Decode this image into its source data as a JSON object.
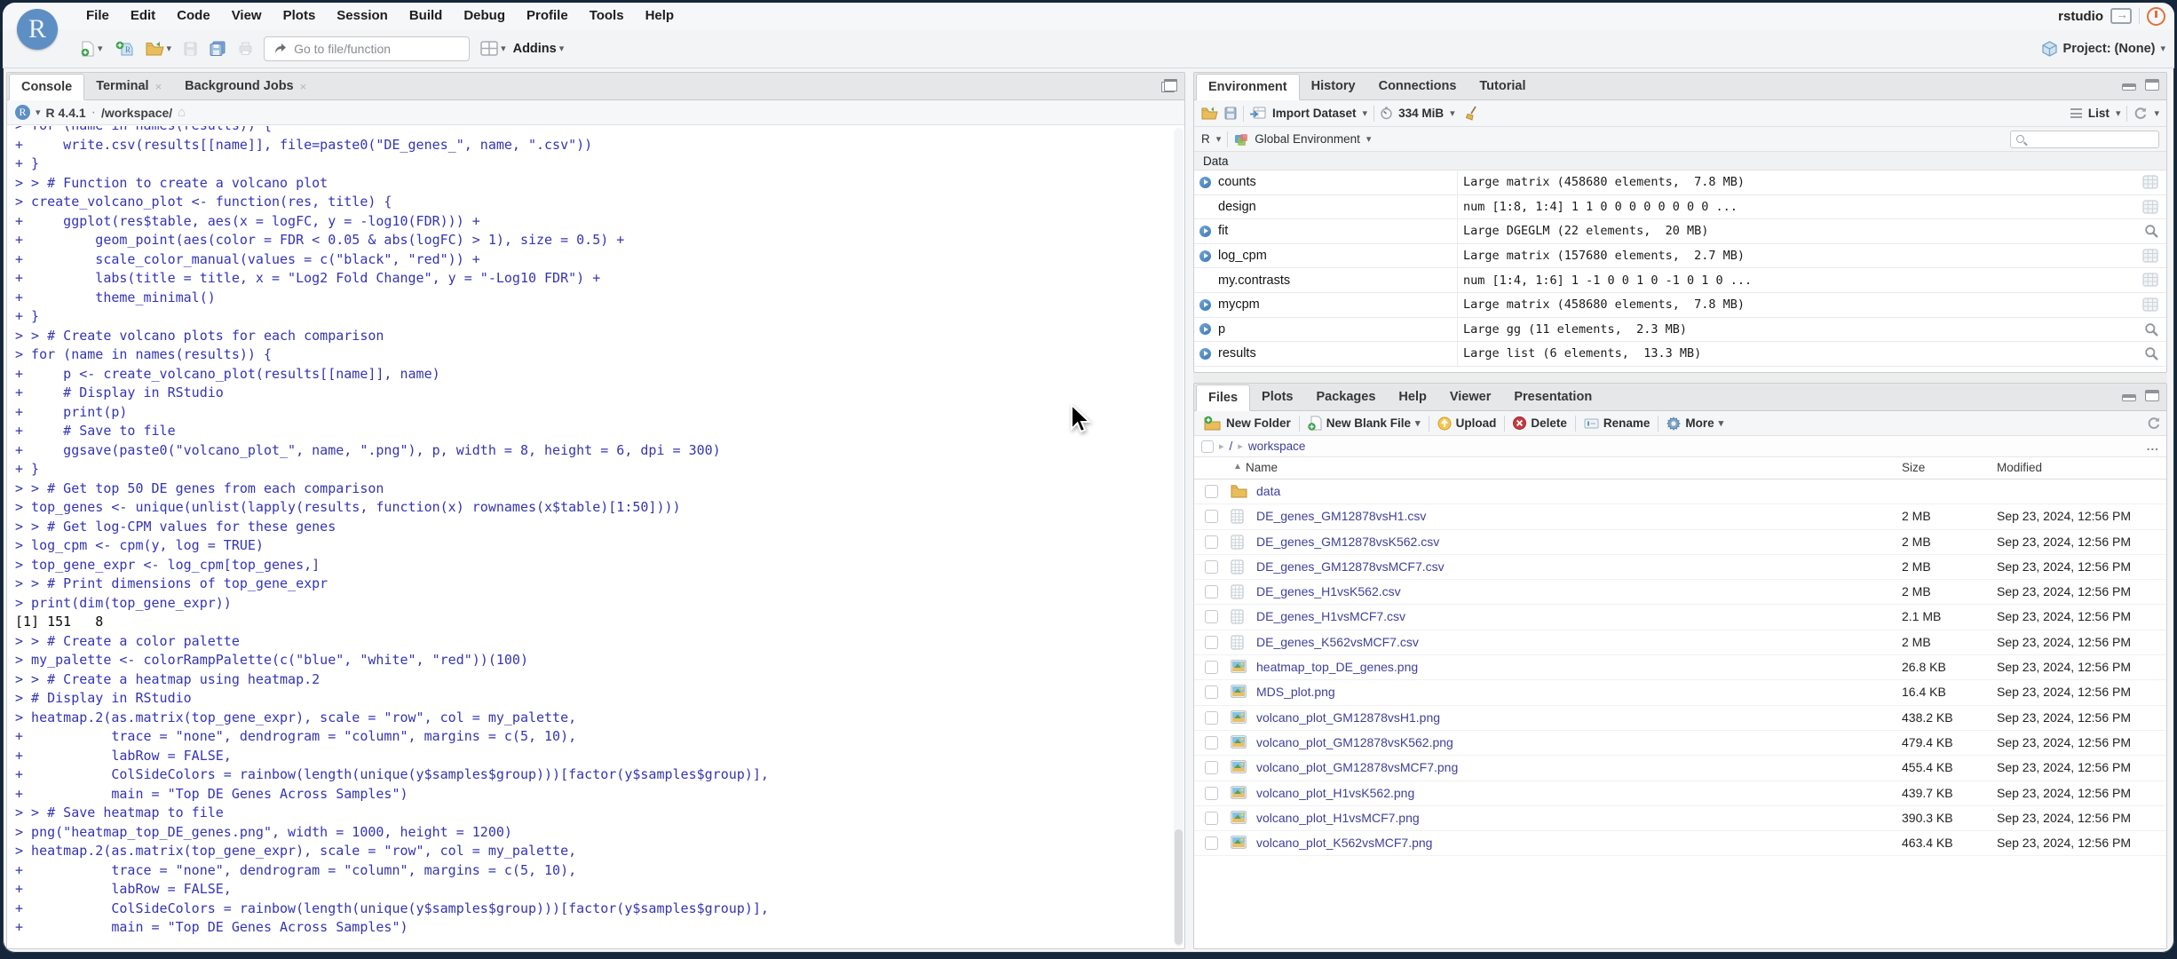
{
  "menubar": {
    "logo_letter": "R",
    "items": [
      "File",
      "Edit",
      "Code",
      "View",
      "Plots",
      "Session",
      "Build",
      "Debug",
      "Profile",
      "Tools",
      "Help"
    ],
    "session_label": "rstudio"
  },
  "toolbar": {
    "buttons": [
      {
        "icon": "new-file-icon",
        "dropdown": true
      },
      {
        "icon": "new-project-icon",
        "dropdown": false
      },
      {
        "icon": "open-file-icon",
        "dropdown": true
      },
      {
        "icon": "save-icon",
        "dropdown": false
      },
      {
        "icon": "save-all-icon",
        "dropdown": false
      },
      {
        "icon": "print-icon",
        "dropdown": false
      }
    ],
    "goto_placeholder": "Go to file/function",
    "addins_label": "Addins",
    "project_label": "Project: (None)"
  },
  "console": {
    "tabs": [
      {
        "label": "Console",
        "active": true,
        "closable": false
      },
      {
        "label": "Terminal",
        "active": false,
        "closable": true
      },
      {
        "label": "Background Jobs",
        "active": false,
        "closable": true
      }
    ],
    "r_version": "R 4.4.1",
    "separator": "·",
    "working_dir": "/workspace/",
    "lines": [
      {
        "t": "> for (name in names(results)) {"
      },
      {
        "t": "+     write.csv(results[[name]], file=paste0(\"DE_genes_\", name, \".csv\"))"
      },
      {
        "t": "+ }"
      },
      {
        "t": "> > # Function to create a volcano plot"
      },
      {
        "t": "> create_volcano_plot <- function(res, title) {"
      },
      {
        "t": "+     ggplot(res$table, aes(x = logFC, y = -log10(FDR))) +"
      },
      {
        "t": "+         geom_point(aes(color = FDR < 0.05 & abs(logFC) > 1), size = 0.5) +"
      },
      {
        "t": "+         scale_color_manual(values = c(\"black\", \"red\")) +"
      },
      {
        "t": "+         labs(title = title, x = \"Log2 Fold Change\", y = \"-Log10 FDR\") +"
      },
      {
        "t": "+         theme_minimal()"
      },
      {
        "t": "+ }"
      },
      {
        "t": "> > # Create volcano plots for each comparison"
      },
      {
        "t": "> for (name in names(results)) {"
      },
      {
        "t": "+     p <- create_volcano_plot(results[[name]], name)"
      },
      {
        "t": "+     # Display in RStudio"
      },
      {
        "t": "+     print(p)"
      },
      {
        "t": "+     # Save to file"
      },
      {
        "t": "+     ggsave(paste0(\"volcano_plot_\", name, \".png\"), p, width = 8, height = 6, dpi = 300)"
      },
      {
        "t": "+ }"
      },
      {
        "t": "> > # Get top 50 DE genes from each comparison"
      },
      {
        "t": "> top_genes <- unique(unlist(lapply(results, function(x) rownames(x$table)[1:50])))"
      },
      {
        "t": "> > # Get log-CPM values for these genes"
      },
      {
        "t": "> log_cpm <- cpm(y, log = TRUE)"
      },
      {
        "t": "> top_gene_expr <- log_cpm[top_genes,]"
      },
      {
        "t": "> > # Print dimensions of top_gene_expr"
      },
      {
        "t": "> print(dim(top_gene_expr))"
      },
      {
        "t": "[1] 151   8",
        "o": true
      },
      {
        "t": "> > # Create a color palette"
      },
      {
        "t": "> my_palette <- colorRampPalette(c(\"blue\", \"white\", \"red\"))(100)"
      },
      {
        "t": "> > # Create a heatmap using heatmap.2"
      },
      {
        "t": "> # Display in RStudio"
      },
      {
        "t": "> heatmap.2(as.matrix(top_gene_expr), scale = \"row\", col = my_palette,"
      },
      {
        "t": "+           trace = \"none\", dendrogram = \"column\", margins = c(5, 10),"
      },
      {
        "t": "+           labRow = FALSE,"
      },
      {
        "t": "+           ColSideColors = rainbow(length(unique(y$samples$group)))[factor(y$samples$group)],"
      },
      {
        "t": "+           main = \"Top DE Genes Across Samples\")"
      },
      {
        "t": "> > # Save heatmap to file"
      },
      {
        "t": "> png(\"heatmap_top_DE_genes.png\", width = 1000, height = 1200)"
      },
      {
        "t": "> heatmap.2(as.matrix(top_gene_expr), scale = \"row\", col = my_palette,"
      },
      {
        "t": "+           trace = \"none\", dendrogram = \"column\", margins = c(5, 10),"
      },
      {
        "t": "+           labRow = FALSE,"
      },
      {
        "t": "+           ColSideColors = rainbow(length(unique(y$samples$group)))[factor(y$samples$group)],"
      },
      {
        "t": "+           main = \"Top DE Genes Across Samples\")"
      }
    ]
  },
  "environment": {
    "tabs": [
      {
        "label": "Environment",
        "active": true
      },
      {
        "label": "History",
        "active": false
      },
      {
        "label": "Connections",
        "active": false
      },
      {
        "label": "Tutorial",
        "active": false
      }
    ],
    "import_label": "Import Dataset",
    "memory_label": "334 MiB",
    "list_label": "List",
    "r_scope_label": "R",
    "env_scope_label": "Global Environment",
    "section_label": "Data",
    "items": [
      {
        "name": "counts",
        "value": "Large matrix (458680 elements,  7.8 MB)",
        "expandable": true,
        "action": "grid-icon"
      },
      {
        "name": "design",
        "value": "num [1:8, 1:4] 1 1 0 0 0 0 0 0 0 0 ...",
        "expandable": false,
        "action": "grid-icon"
      },
      {
        "name": "fit",
        "value": "Large DGEGLM (22 elements,  20 MB)",
        "expandable": true,
        "action": "magnifier-icon"
      },
      {
        "name": "log_cpm",
        "value": "Large matrix (157680 elements,  2.7 MB)",
        "expandable": true,
        "action": "grid-icon"
      },
      {
        "name": "my.contrasts",
        "value": "num [1:4, 1:6] 1 -1 0 0 1 0 -1 0 1 0 ...",
        "expandable": false,
        "action": "grid-icon"
      },
      {
        "name": "mycpm",
        "value": "Large matrix (458680 elements,  7.8 MB)",
        "expandable": true,
        "action": "grid-icon"
      },
      {
        "name": "p",
        "value": "Large gg (11 elements,  2.3 MB)",
        "expandable": true,
        "action": "magnifier-icon"
      },
      {
        "name": "results",
        "value": "Large list (6 elements,  13.3 MB)",
        "expandable": true,
        "action": "magnifier-icon"
      }
    ]
  },
  "files": {
    "tabs": [
      {
        "label": "Files",
        "active": true
      },
      {
        "label": "Plots",
        "active": false
      },
      {
        "label": "Packages",
        "active": false
      },
      {
        "label": "Help",
        "active": false
      },
      {
        "label": "Viewer",
        "active": false
      },
      {
        "label": "Presentation",
        "active": false
      }
    ],
    "toolbar_buttons": [
      {
        "label": "New Folder",
        "icon": "new-folder-icon",
        "dropdown": false
      },
      {
        "label": "New Blank File",
        "icon": "new-blank-file-icon",
        "dropdown": true
      },
      {
        "label": "Upload",
        "icon": "upload-icon",
        "dropdown": false
      },
      {
        "label": "Delete",
        "icon": "delete-icon",
        "dropdown": false
      },
      {
        "label": "Rename",
        "icon": "rename-icon",
        "dropdown": false
      },
      {
        "label": "More",
        "icon": "gear-icon",
        "dropdown": true
      }
    ],
    "breadcrumb": {
      "root": "/",
      "folder": "workspace",
      "more": "..."
    },
    "columns": {
      "name": "Name",
      "size": "Size",
      "modified": "Modified"
    },
    "rows": [
      {
        "name": "data",
        "icon": "folder-icon",
        "size": "",
        "modified": ""
      },
      {
        "name": "DE_genes_GM12878vsH1.csv",
        "icon": "spreadsheet-icon",
        "size": "2 MB",
        "modified": "Sep 23, 2024, 12:56 PM"
      },
      {
        "name": "DE_genes_GM12878vsK562.csv",
        "icon": "spreadsheet-icon",
        "size": "2 MB",
        "modified": "Sep 23, 2024, 12:56 PM"
      },
      {
        "name": "DE_genes_GM12878vsMCF7.csv",
        "icon": "spreadsheet-icon",
        "size": "2 MB",
        "modified": "Sep 23, 2024, 12:56 PM"
      },
      {
        "name": "DE_genes_H1vsK562.csv",
        "icon": "spreadsheet-icon",
        "size": "2 MB",
        "modified": "Sep 23, 2024, 12:56 PM"
      },
      {
        "name": "DE_genes_H1vsMCF7.csv",
        "icon": "spreadsheet-icon",
        "size": "2.1 MB",
        "modified": "Sep 23, 2024, 12:56 PM"
      },
      {
        "name": "DE_genes_K562vsMCF7.csv",
        "icon": "spreadsheet-icon",
        "size": "2 MB",
        "modified": "Sep 23, 2024, 12:56 PM"
      },
      {
        "name": "heatmap_top_DE_genes.png",
        "icon": "image-icon",
        "size": "26.8 KB",
        "modified": "Sep 23, 2024, 12:56 PM"
      },
      {
        "name": "MDS_plot.png",
        "icon": "image-icon",
        "size": "16.4 KB",
        "modified": "Sep 23, 2024, 12:56 PM"
      },
      {
        "name": "volcano_plot_GM12878vsH1.png",
        "icon": "image-icon",
        "size": "438.2 KB",
        "modified": "Sep 23, 2024, 12:56 PM"
      },
      {
        "name": "volcano_plot_GM12878vsK562.png",
        "icon": "image-icon",
        "size": "479.4 KB",
        "modified": "Sep 23, 2024, 12:56 PM"
      },
      {
        "name": "volcano_plot_GM12878vsMCF7.png",
        "icon": "image-icon",
        "size": "455.4 KB",
        "modified": "Sep 23, 2024, 12:56 PM"
      },
      {
        "name": "volcano_plot_H1vsK562.png",
        "icon": "image-icon",
        "size": "439.7 KB",
        "modified": "Sep 23, 2024, 12:56 PM"
      },
      {
        "name": "volcano_plot_H1vsMCF7.png",
        "icon": "image-icon",
        "size": "390.3 KB",
        "modified": "Sep 23, 2024, 12:56 PM"
      },
      {
        "name": "volcano_plot_K562vsMCF7.png",
        "icon": "image-icon",
        "size": "463.4 KB",
        "modified": "Sep 23, 2024, 12:56 PM"
      }
    ]
  }
}
